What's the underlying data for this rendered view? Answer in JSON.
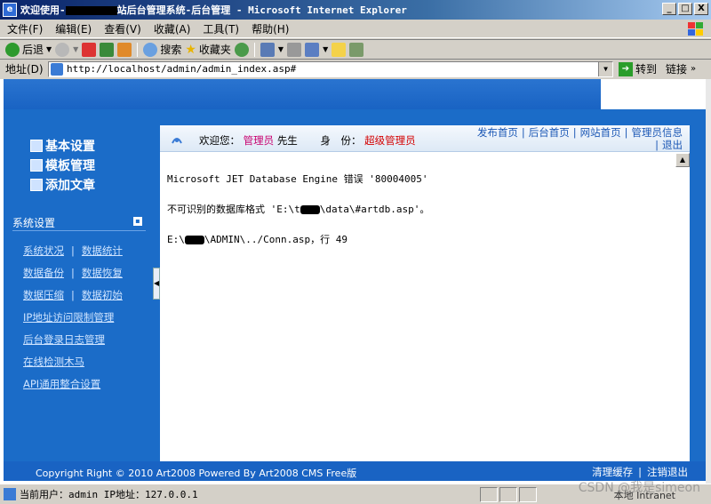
{
  "window": {
    "title_prefix": "欢迎使用-",
    "title_suffix": "站后台管理系统-后台管理 - Microsoft Internet Explorer",
    "btn_min": "_",
    "btn_max": "□",
    "btn_close": "X"
  },
  "menubar": {
    "items": [
      "文件(F)",
      "编辑(E)",
      "查看(V)",
      "收藏(A)",
      "工具(T)",
      "帮助(H)"
    ]
  },
  "toolbar": {
    "back": "后退",
    "search": "搜索",
    "favorites": "收藏夹"
  },
  "addressbar": {
    "label": "地址(D)",
    "url": "http://localhost/admin/admin_index.asp#",
    "go": "转到",
    "links": "链接"
  },
  "sidebar": {
    "main_nav": [
      "基本设置",
      "模板管理",
      "添加文章"
    ],
    "section_title": "系统设置",
    "toggle": "▪",
    "rows": [
      [
        "系统状况",
        "数据统计"
      ],
      [
        "数据备份",
        "数据恢复"
      ],
      [
        "数据压缩",
        "数据初始"
      ],
      [
        "IP地址访问限制管理"
      ],
      [
        "后台登录日志管理"
      ],
      [
        "在线检测木马"
      ],
      [
        "API通用整合设置"
      ]
    ],
    "bar": "|"
  },
  "header": {
    "welcome": "欢迎您：",
    "user": "管理员",
    "honorific": "先生",
    "role_label": "身　份：",
    "role": "超级管理员",
    "links": [
      "发布首页",
      "后台首页",
      "网站首页",
      "管理员信息",
      "退出"
    ]
  },
  "error": {
    "line1": "Microsoft JET Database Engine 错误 '80004005'",
    "line2_a": "不可识别的数据库格式 'E:\\t",
    "line2_b": "\\data\\#artdb.asp'。",
    "line3_a": "E:\\",
    "line3_b": "\\ADMIN\\../Conn.asp，行 49"
  },
  "footer": {
    "copyright": "Copyright Right © 2010 Art2008 Powered By Art2008 CMS Free版",
    "clear_cache": "清理缓存",
    "logout": "注销退出"
  },
  "statusbar": {
    "text": "当前用户：admin  IP地址：127.0.0.1",
    "zone": "本地 Intranet",
    "watermark": "CSDN @我是simeon"
  },
  "colors": {
    "panel_blue": "#1b6cc8",
    "role_red": "#d40000",
    "user_pink": "#c8006e"
  }
}
